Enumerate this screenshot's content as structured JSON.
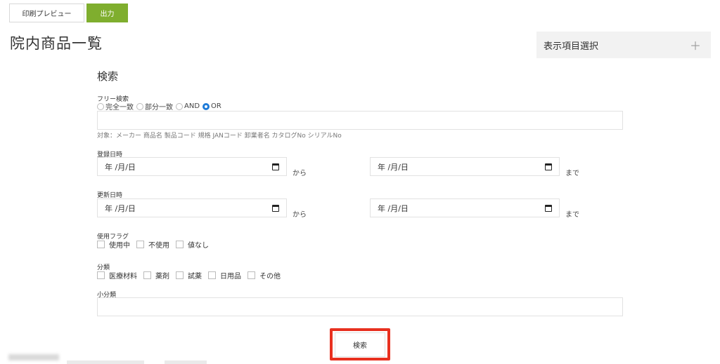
{
  "toolbar": {
    "preview_label": "印刷プレビュー",
    "output_label": "出力"
  },
  "page_title": "院内商品一覧",
  "column_panel": {
    "title": "表示項目選択",
    "expand_icon": "plus-icon"
  },
  "search": {
    "title": "検索",
    "free_label": "フリー検索",
    "match_options": [
      "完全一致",
      "部分一致",
      "AND",
      "OR"
    ],
    "selected_option": "OR",
    "free_value": "",
    "hint": "対象：メーカー 商品名 製品コード 規格 JANコード 卸業者名 カタログNo シリアルNo",
    "registered_label": "登録日時",
    "updated_label": "更新日時",
    "date_placeholder": "年 /月/日",
    "from_suffix": "から",
    "to_suffix": "まで",
    "usage_label": "使用フラグ",
    "usage_options": [
      "使用中",
      "不使用",
      "値なし"
    ],
    "category_label": "分類",
    "category_options": [
      "医療材料",
      "薬剤",
      "試薬",
      "日用品",
      "その他"
    ],
    "subcategory_label": "小分類",
    "subcategory_value": "",
    "submit_label": "検索"
  },
  "colors": {
    "accent_green": "#7fae2e",
    "radio_blue": "#1e7bd8",
    "highlight_red": "#e8301f"
  }
}
